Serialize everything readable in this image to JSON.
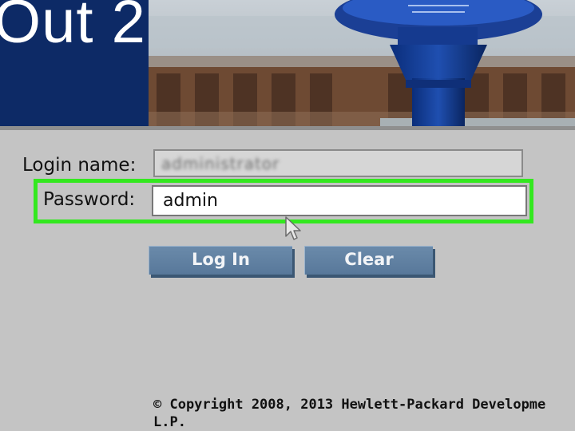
{
  "banner": {
    "title_fragment": "Out 2"
  },
  "form": {
    "login_label": "Login name:",
    "login_value_obscured": "administrator",
    "password_label": "Password:",
    "password_value": "admin"
  },
  "buttons": {
    "login_label": "Log In",
    "clear_label": "Clear"
  },
  "footer": {
    "copyright_line1": "© Copyright 2008, 2013 Hewlett-Packard Developme",
    "copyright_line2": "L.P."
  },
  "colors": {
    "banner_blue": "#0d2a66",
    "highlight_green": "#33e81f",
    "button_blue": "#6a8aaa",
    "page_gray": "#c4c4c4"
  },
  "icons": {
    "cursor": "mouse-pointer-icon"
  }
}
